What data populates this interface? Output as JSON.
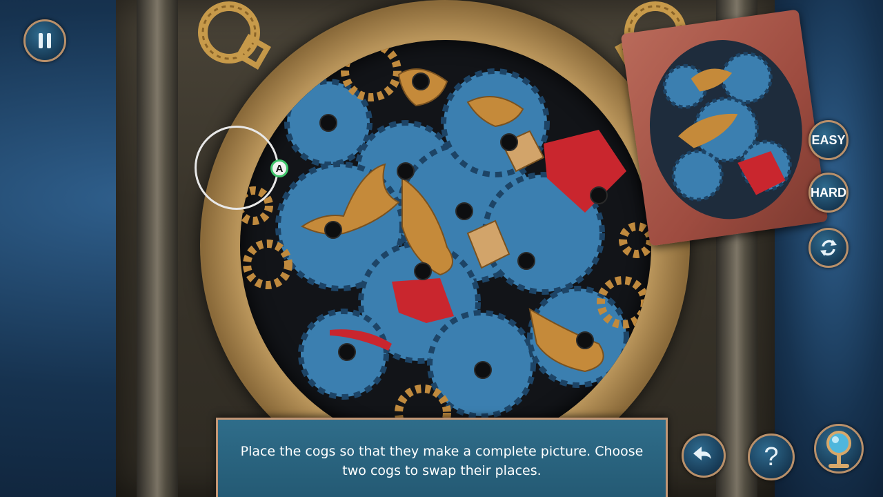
{
  "hud": {
    "pause_icon": "pause-icon",
    "easy_label": "EASY",
    "hard_label": "HARD",
    "reset_icon": "reset-icon",
    "undo_icon": "undo-icon",
    "hint_icon": "question-mark-icon",
    "magnifier_icon": "magnifying-glass-icon"
  },
  "puzzle": {
    "selector_label": "A"
  },
  "message": {
    "text": "Place the cogs so that they make a complete picture. Choose two cogs to swap their places."
  },
  "colors": {
    "hud_blue": "#245a74",
    "hud_border": "#c29675",
    "cog_blue": "#3f86b8",
    "cog_gold": "#c08a3e",
    "accent_red": "#c9262e",
    "selector_green": "#3fc46a"
  }
}
